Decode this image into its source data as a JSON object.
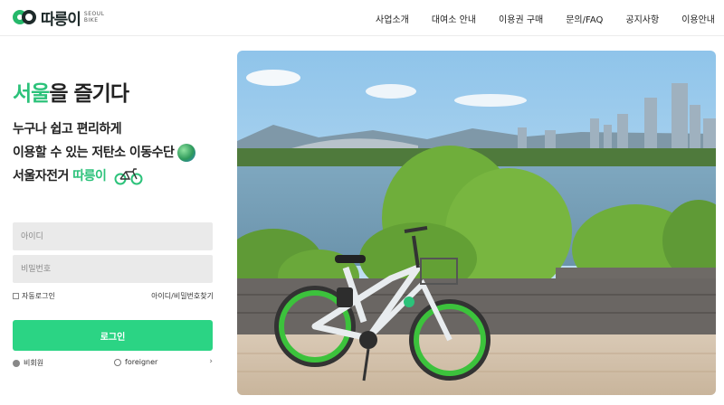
{
  "header": {
    "logo_text": "따릉이",
    "logo_sub_1": "SEOUL",
    "logo_sub_2": "BIKE",
    "nav": [
      "사업소개",
      "대여소 안내",
      "이용권 구매",
      "문의/FAQ",
      "공지사항",
      "이용안내"
    ]
  },
  "hero_text": {
    "headline_accent": "서울",
    "headline_rest": "을 즐기다",
    "line1": "누구나 쉽고 편리하게",
    "line2": "이용할 수 있는 저탄소 이동수단",
    "line3_prefix": "서울자전거 ",
    "line3_accent": "따릉이"
  },
  "login": {
    "id_placeholder": "아이디",
    "pw_placeholder": "비밀번호",
    "auto_login_label": "자동로그인",
    "find_link": "아이디/비밀번호찾기",
    "login_button": "로그인",
    "nonmember_label": "비회원",
    "foreigner_label": "foreigner",
    "chevron": "›"
  },
  "colors": {
    "accent": "#2cc27a",
    "button": "#2bd484",
    "field_bg": "#eaeaea"
  }
}
